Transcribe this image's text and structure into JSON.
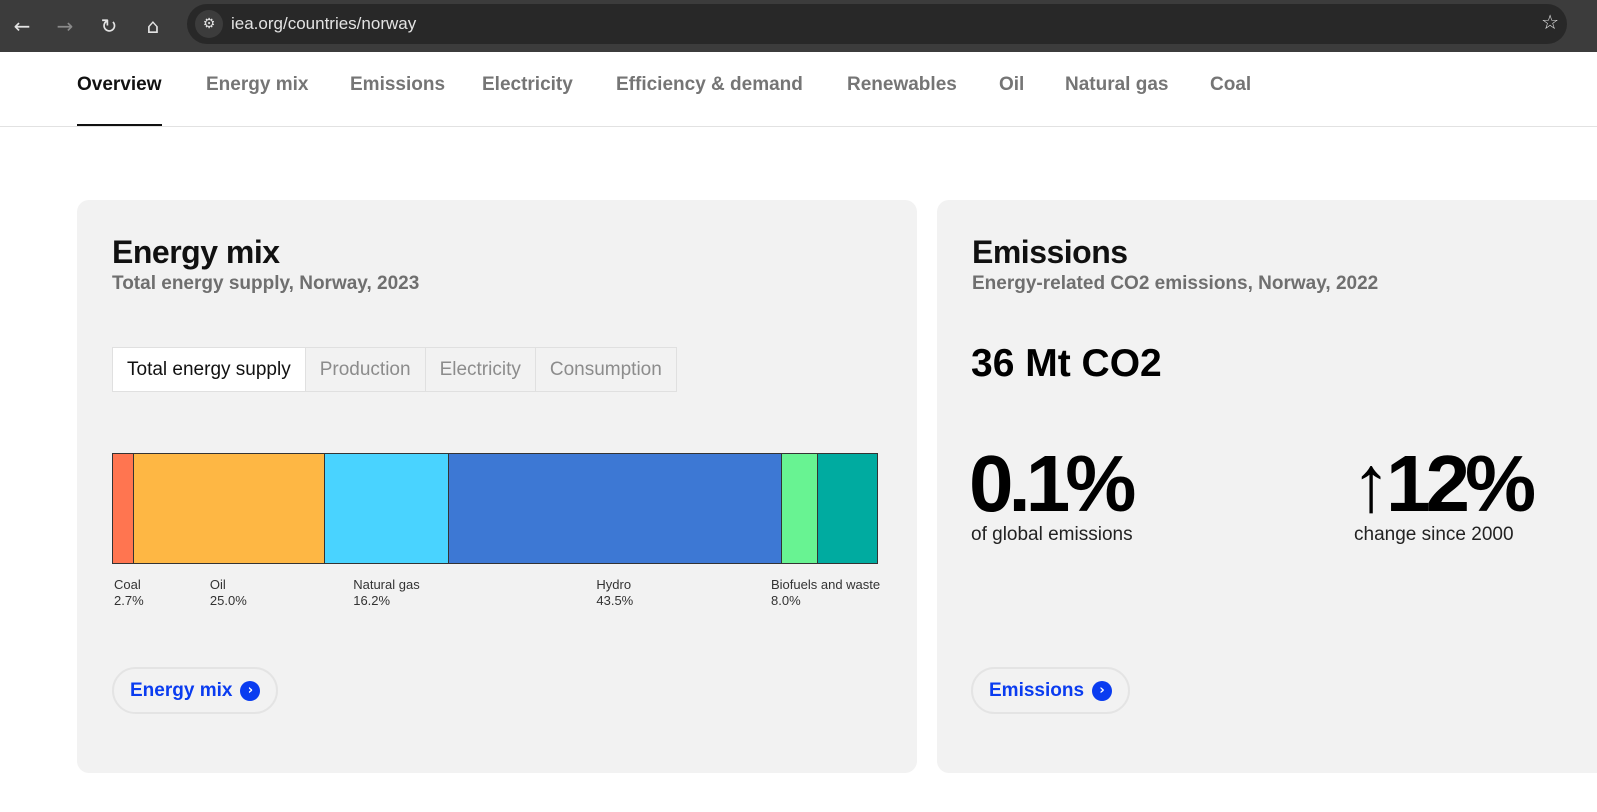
{
  "browser": {
    "url": "iea.org/countries/norway",
    "icons": [
      "back-icon",
      "forward-icon",
      "reload-icon",
      "home-icon",
      "site-settings-icon",
      "star-icon"
    ]
  },
  "nav": {
    "items": [
      "Overview",
      "Energy mix",
      "Emissions",
      "Electricity",
      "Efficiency & demand",
      "Renewables",
      "Oil",
      "Natural gas",
      "Coal"
    ],
    "active": "Overview"
  },
  "energy_mix": {
    "title": "Energy mix",
    "subtitle": "Total energy supply, Norway, 2023",
    "tabs": [
      "Total energy supply",
      "Production",
      "Electricity",
      "Consumption"
    ],
    "active_tab": "Total energy supply",
    "button": "Energy mix"
  },
  "chart_data": {
    "type": "bar",
    "stacked": "horizontal-100%",
    "segments": [
      {
        "name": "Coal",
        "value": 2.7,
        "label": "2.7%",
        "color": "#ff7550"
      },
      {
        "name": "Oil",
        "value": 25.0,
        "label": "25.0%",
        "color": "#feb744"
      },
      {
        "name": "Natural gas",
        "value": 16.2,
        "label": "16.2%",
        "color": "#49d3ff"
      },
      {
        "name": "Hydro",
        "value": 43.5,
        "label": "43.5%",
        "color": "#3d78d4"
      },
      {
        "name": "",
        "value": 4.6,
        "label": "",
        "color": "#68f392"
      },
      {
        "name": "Biofuels and waste",
        "value": 8.0,
        "label": "8.0%",
        "color": "#00aba0"
      }
    ]
  },
  "emissions": {
    "title": "Emissions",
    "subtitle": "Energy-related CO2 emissions, Norway, 2022",
    "total": "36 Mt CO2",
    "share": "0.1%",
    "share_label": "of global emissions",
    "change": "↑12%",
    "change_label": "change since 2000",
    "button": "Emissions"
  },
  "colors": {
    "accent": "#0a3cf0",
    "card": "#f2f2f2"
  }
}
